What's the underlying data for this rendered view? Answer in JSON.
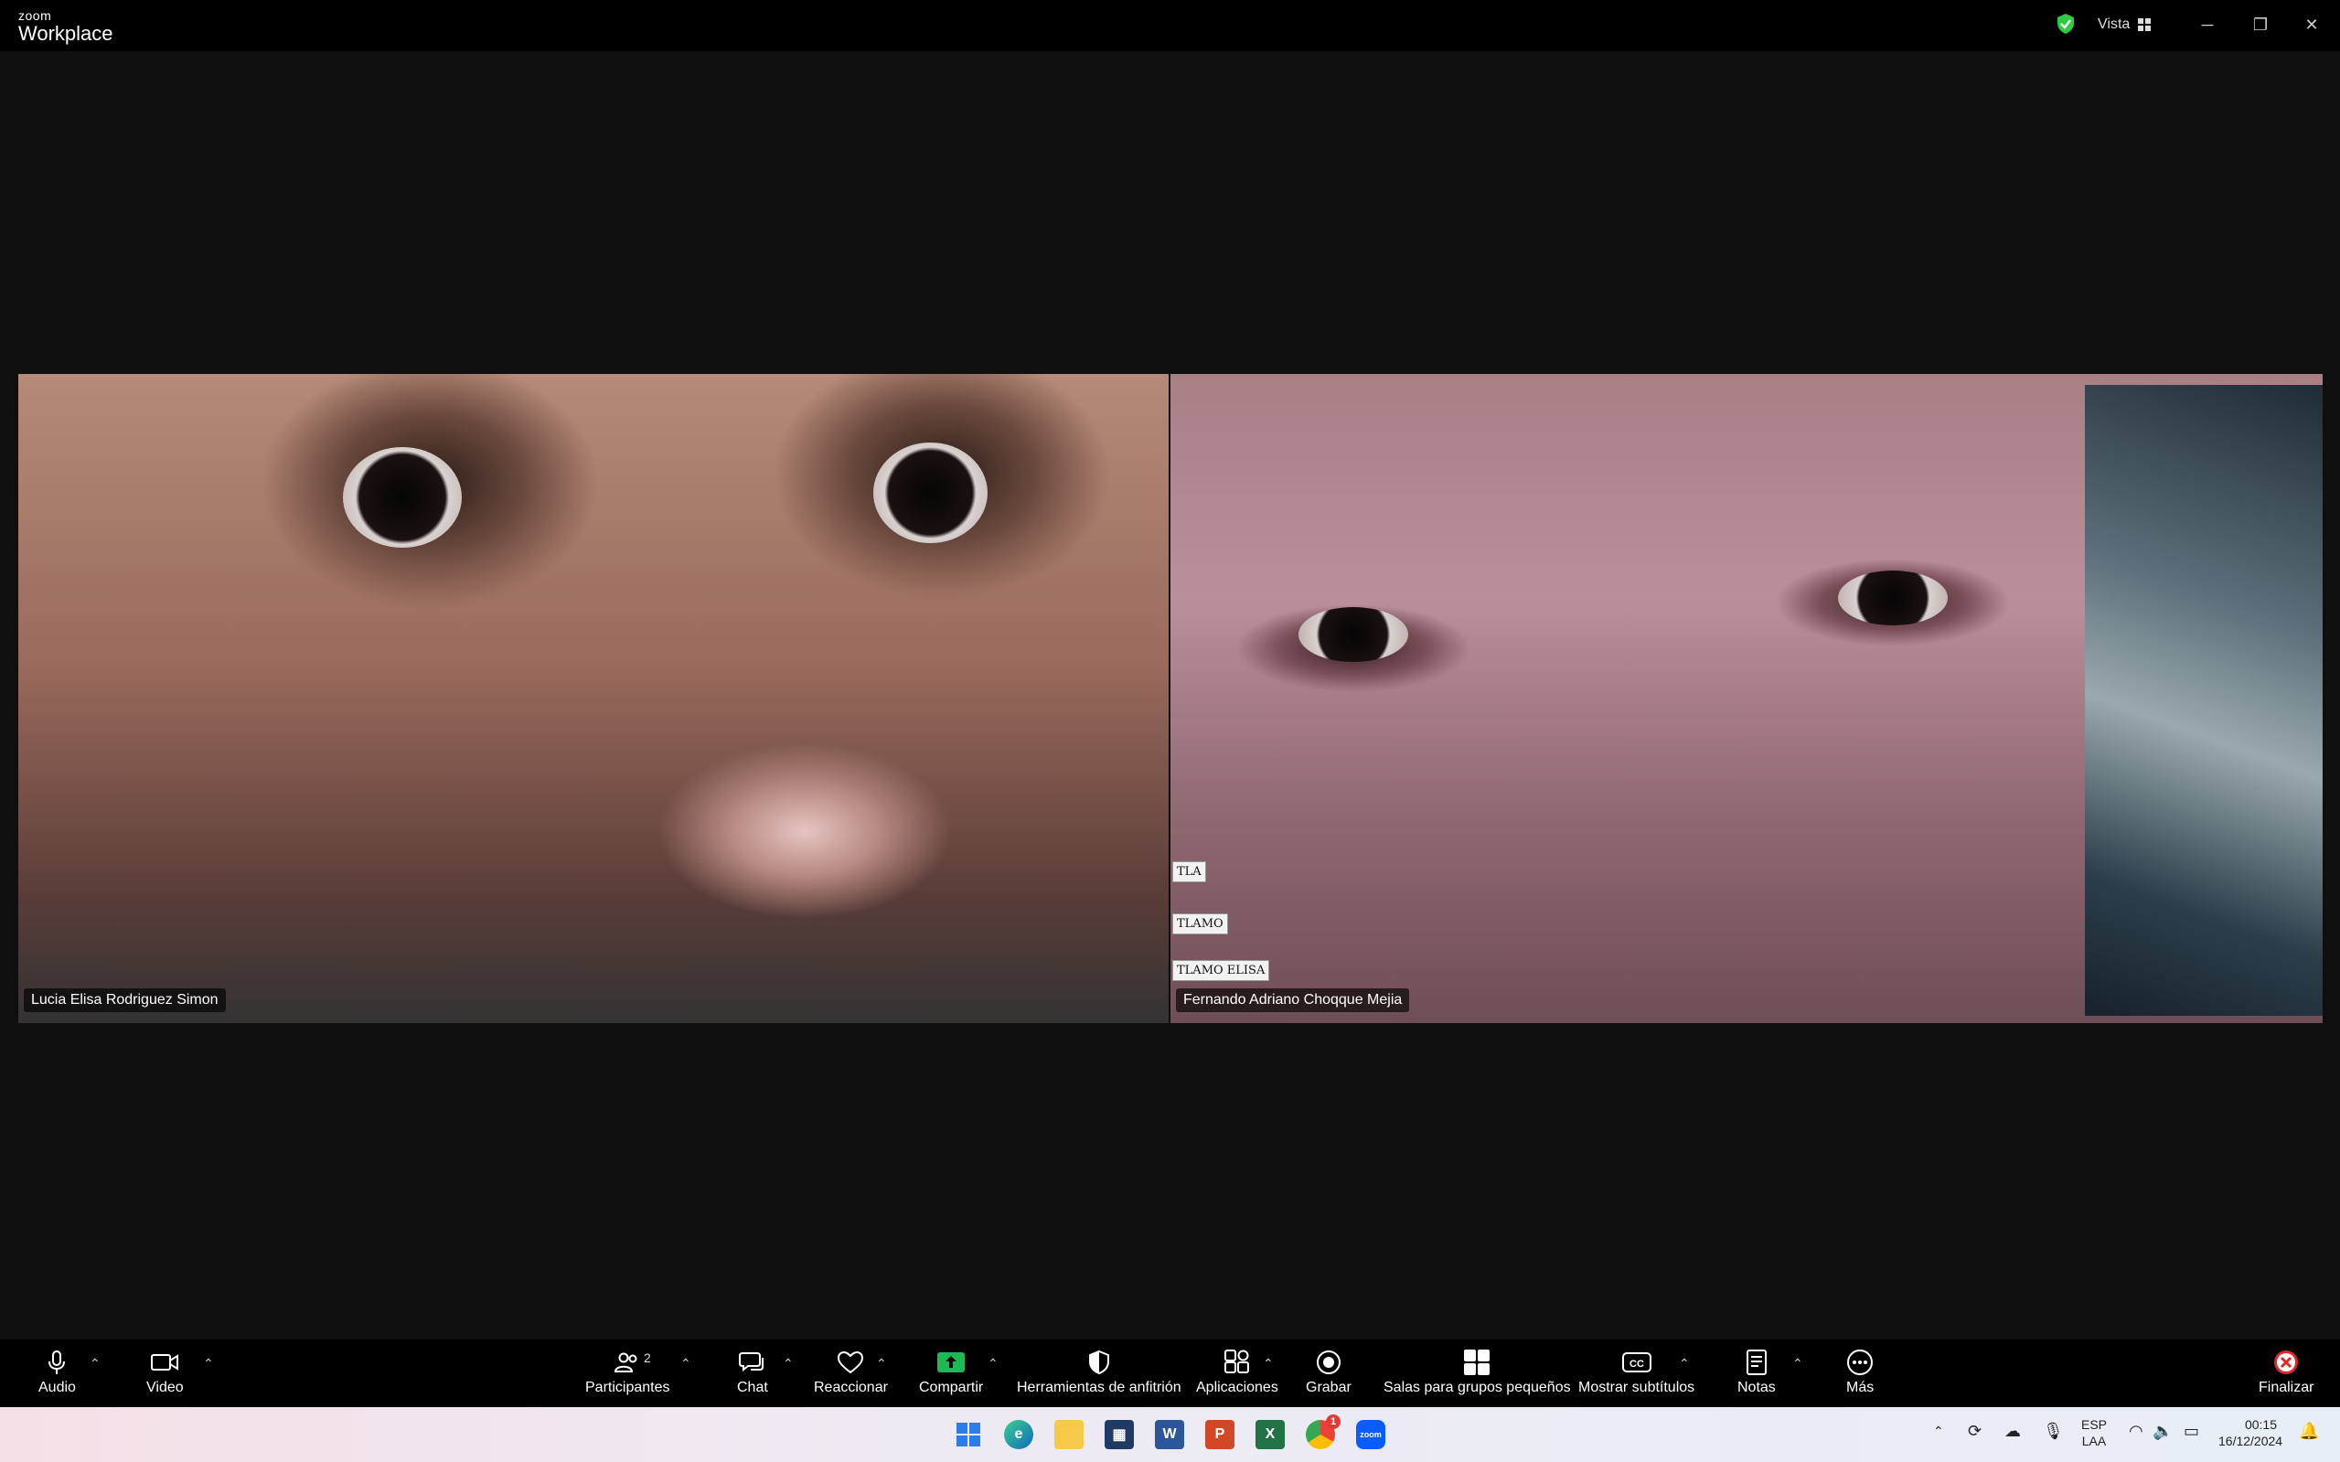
{
  "titlebar": {
    "brand_small": "zoom",
    "brand_big": "Workplace",
    "view_label": "Vista",
    "minimize": "─",
    "restore": "❐",
    "close": "✕"
  },
  "participants": [
    {
      "name": "Lucia Elisa Rodriguez Simon"
    },
    {
      "name": "Fernando Adriano Choqque Mejia"
    }
  ],
  "notes": [
    "TLA",
    "TLAMO",
    "TLAMO ELISA"
  ],
  "toolbar": {
    "audio": "Audio",
    "video": "Video",
    "participants": "Participantes",
    "participants_count": "2",
    "chat": "Chat",
    "react": "Reaccionar",
    "share": "Compartir",
    "host_tools": "Herramientas de anfitrión",
    "apps": "Aplicaciones",
    "record": "Grabar",
    "breakout": "Salas para grupos pequeños",
    "captions": "Mostrar subtítulos",
    "notes": "Notas",
    "more": "Más",
    "end": "Finalizar"
  },
  "taskbar": {
    "apps": [
      "windows-start-icon",
      "edge-icon",
      "file-explorer-icon",
      "microsoft-store-icon",
      "word-icon",
      "powerpoint-icon",
      "excel-icon",
      "chrome-icon",
      "zoom-icon"
    ],
    "chrome_badge": "1",
    "lang_top": "ESP",
    "lang_bottom": "LAA",
    "time": "00:15",
    "date": "16/12/2024"
  },
  "colors": {
    "share_green": "#1db954",
    "end_red": "#e02828",
    "shield_green": "#2ecc40"
  }
}
